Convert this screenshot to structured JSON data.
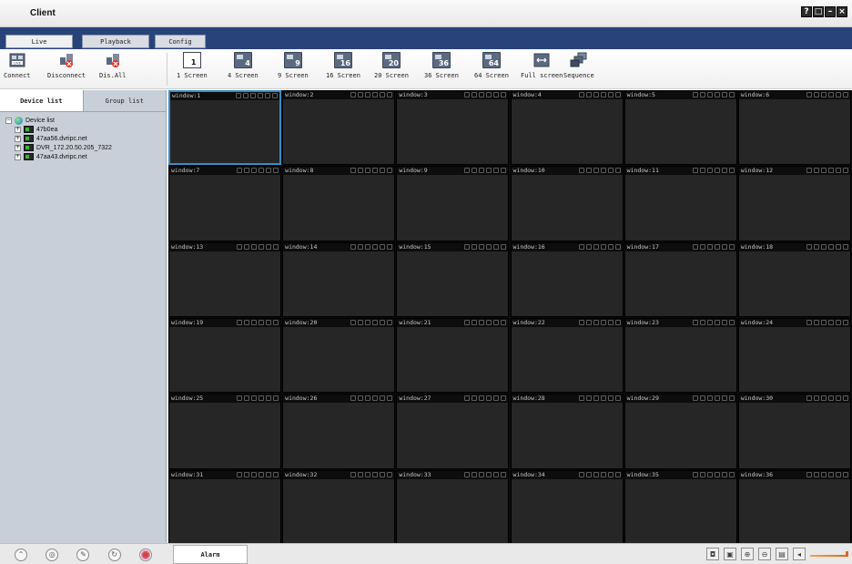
{
  "window": {
    "title": "Client",
    "controls": [
      "?",
      "□",
      "–",
      "×"
    ]
  },
  "menu": {
    "tabs": [
      {
        "label": "Live",
        "active": true
      },
      {
        "label": "Playback",
        "active": false
      },
      {
        "label": "Config",
        "active": false
      }
    ]
  },
  "toolbar": {
    "connection_buttons": [
      {
        "label": "Connect",
        "icon": "connect-icon"
      },
      {
        "label": "Disconnect",
        "icon": "disconnect-icon"
      },
      {
        "label": "Dis.All",
        "icon": "disconnect-all-icon"
      }
    ],
    "screen_buttons": [
      {
        "label": "1 Screen",
        "icon": "1"
      },
      {
        "label": "4 Screen",
        "icon": "4"
      },
      {
        "label": "9 Screen",
        "icon": "9"
      },
      {
        "label": "16 Screen",
        "icon": "16"
      },
      {
        "label": "20 Screen",
        "icon": "20"
      },
      {
        "label": "36 Screen",
        "icon": "36"
      },
      {
        "label": "64 Screen",
        "icon": "64"
      },
      {
        "label": "Full screen",
        "icon": "full-screen-icon"
      },
      {
        "label": "Sequence",
        "icon": "sequence-icon"
      }
    ]
  },
  "sidebar": {
    "tabs": [
      {
        "label": "Device list",
        "active": true
      },
      {
        "label": "Group list",
        "active": false
      }
    ],
    "tree": {
      "root": "Device list",
      "devices": [
        "47b0ea",
        "47aa56.dvripc.net",
        "DVR_172.20.50.205_7322",
        "47aa43.dvripc.net"
      ]
    }
  },
  "video_grid": {
    "columns": 6,
    "rows": 6,
    "selected": "window:1",
    "windows": [
      "window:1",
      "window:2",
      "window:3",
      "window:4",
      "window:5",
      "window:6",
      "window:7",
      "window:8",
      "window:9",
      "window:10",
      "window:11",
      "window:12",
      "window:13",
      "window:14",
      "window:15",
      "window:16",
      "window:17",
      "window:18",
      "window:19",
      "window:20",
      "window:21",
      "window:22",
      "window:23",
      "window:24",
      "window:25",
      "window:26",
      "window:27",
      "window:28",
      "window:29",
      "window:30",
      "window:31",
      "window:32",
      "window:33",
      "window:34",
      "window:35",
      "window:36"
    ]
  },
  "bottom": {
    "alarm_tab": "Alarm",
    "left_icons": [
      "ptz-icon",
      "record-icon",
      "talk-icon",
      "refresh-icon",
      "color-icon"
    ],
    "right_icons": [
      "snapshot-icon",
      "record-icon",
      "zoom-in-icon",
      "zoom-out-icon",
      "playback-icon",
      "volume-icon"
    ],
    "volume_level": 1.0
  },
  "colors": {
    "menu_band": "#27437a",
    "selected_window": "#3a8bc7",
    "window_bg": "#262626"
  }
}
